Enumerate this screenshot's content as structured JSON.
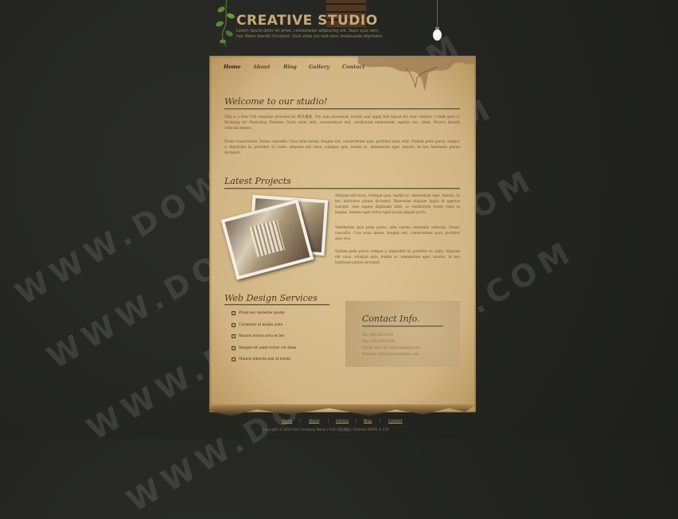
{
  "header": {
    "title": "CREATIVE STUDIO",
    "tagline": "Lorem ipsum dolor sit amet, consectetur adipiscing elit. Nunc quis sem nec libero blandit tincidunt. Duis vitae est sed nunc malesuada dignissim."
  },
  "nav": {
    "items": [
      {
        "label": "Home"
      },
      {
        "label": "About"
      },
      {
        "label": "Blog"
      },
      {
        "label": "Gallery"
      },
      {
        "label": "Contact"
      }
    ]
  },
  "welcome": {
    "heading": "Welcome to our studio!",
    "para1": "This is a free CSS template provided by 网页模板. You may download, modify and apply this layout for your website. Credit goes to Brodesig for Photoshop Brushes. Nulla enim nibh, consectetuer sed, vestibulum elementum, sagittis nec, diam. Mauris blandit vehicula neque.",
    "para2": "Proin consectetuer. Donec convallis. Cras urna metus, feugiat sed, consectetuer quis, porttitor quis, erat. Nullam pede purus, tempor a, imperdiet in, porttitor ut, nulla. Aliquam elit risus, volutpat quis, mattis ac, elementum eget, mauris. In hac habitasse platea dictumst."
  },
  "projects": {
    "heading": "Latest Projects",
    "para1": "Aliquam elit risus, volutpat quis, mattis ac, elementum eget, mauris. In hac habitasse platea dictumst. Maecenas aliquam ligula id egestas suscipit, sem sapien dignissim nibh, ac vestibulum lorem risus in magna. Aenean eget tortor eget ipsum aliquet porta.",
    "para2": "Vestibulum quis pede purus, sem cursus venenatis vehicula. Donec convallis. Cras urna metus, feugiat sed, consectetuer quis, porttitor quis erat.",
    "para3": "Nullam pede purus, tempor a, imperdiet in, porttitor ut, nulla. Aliquam elit risus, volutpat quis, mattis ac, elementum eget, mauris. In hac habitasse platea dictumst."
  },
  "services": {
    "heading": "Web Design Services",
    "items": [
      {
        "label": "Proin nec molestie ipsum"
      },
      {
        "label": "Curabitur id mollis urna"
      },
      {
        "label": "Mauris luctus arcu et leo"
      },
      {
        "label": "Integer sit amet tortor vel diam"
      },
      {
        "label": "Mauris lobortis nisl id lorem"
      }
    ]
  },
  "contact": {
    "heading": "Contact Info.",
    "tel": "Tel: 000-000-0000",
    "fax": "Fax: 050-250-2500",
    "email": "Email: info (at) yourcompany.com",
    "website": "Website: www.yourcompany.com"
  },
  "footer": {
    "links": [
      "Home",
      "About",
      "Gallery",
      "Blog",
      "Contact"
    ],
    "copyright": "Copyright © 2014 Your Company Name | from 网页模板 | Validate XHTML & CSS"
  }
}
